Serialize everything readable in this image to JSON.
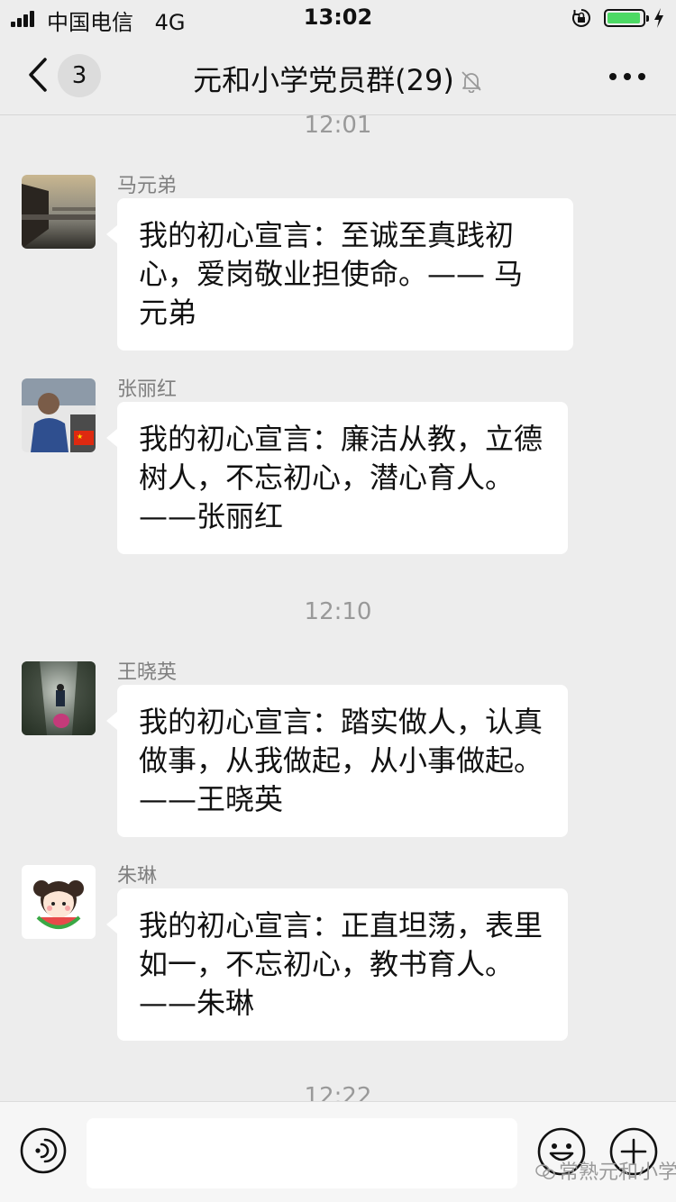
{
  "status_bar": {
    "carrier": "中国电信",
    "network": "4G",
    "time": "13:02",
    "battery_level": 0.95,
    "icons": [
      "signal-icon",
      "orientation-lock-icon",
      "battery-icon",
      "charging-bolt-icon"
    ]
  },
  "header": {
    "unread_count": "3",
    "title": "元和小学党员群(29)",
    "icons": [
      "back-chevron-icon",
      "mute-bell-icon",
      "more-icon"
    ]
  },
  "chat": {
    "timestamps": [
      "12:01",
      "12:10",
      "12:22"
    ],
    "messages": [
      {
        "sender": "马元弟",
        "text": "我的初心宣言：至诚至真践初心，爱岗敬业担使命。—— 马元弟"
      },
      {
        "sender": "张丽红",
        "text": "我的初心宣言：廉洁从教，立德树人，不忘初心，潜心育人。——张丽红"
      },
      {
        "sender": "王晓英",
        "text": "我的初心宣言：踏实做人，认真做事，从我做起，从小事做起。   ——王晓英"
      },
      {
        "sender": "朱琳",
        "text": "我的初心宣言：正直坦荡，表里如一，不忘初心，教书育人。   ——朱琳"
      }
    ]
  },
  "input_bar": {
    "placeholder": "",
    "icons": [
      "voice-icon",
      "emoji-icon",
      "plus-icon"
    ]
  },
  "watermark": "常熟元和小学",
  "colors": {
    "background": "#ededed",
    "bubble": "#ffffff",
    "battery": "#4cd964",
    "muted_text": "#999999"
  }
}
